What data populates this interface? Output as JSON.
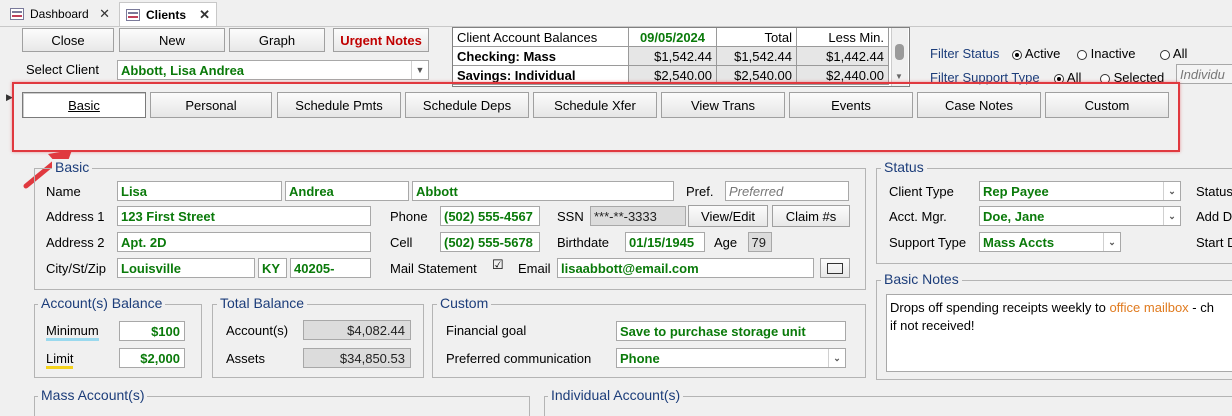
{
  "tabs": {
    "inactive": "Dashboard",
    "active": "Clients"
  },
  "toolbar": {
    "close": "Close",
    "new": "New",
    "graph": "Graph",
    "urgent": "Urgent Notes"
  },
  "select_client": {
    "label": "Select Client",
    "value": "Abbott, Lisa Andrea"
  },
  "balances": {
    "header": [
      "Client Account Balances",
      "09/05/2024",
      "Total",
      "Less Min."
    ],
    "rows": [
      {
        "name": "Checking: Mass",
        "a": "$1,542.44",
        "b": "$1,542.44",
        "c": "$1,442.44"
      },
      {
        "name": "Savings: Individual",
        "a": "$2,540.00",
        "b": "$2,540.00",
        "c": "$2,440.00"
      }
    ]
  },
  "filters": {
    "status_label": "Filter Status",
    "active": "Active",
    "inactive": "Inactive",
    "all": "All",
    "support_label": "Filter Support Type",
    "all2": "All",
    "selected": "Selected",
    "support_value": "Individu"
  },
  "nav": [
    "Basic",
    "Personal",
    "Schedule Pmts",
    "Schedule Deps",
    "Schedule Xfer",
    "View Trans",
    "Events",
    "Case Notes",
    "Custom"
  ],
  "basic": {
    "title": "Basic",
    "name_label": "Name",
    "first": "Lisa",
    "middle": "Andrea",
    "last": "Abbott",
    "pref_label": "Pref.",
    "pref_placeholder": "Preferred",
    "addr1_label": "Address 1",
    "addr1": "123 First Street",
    "addr2_label": "Address 2",
    "addr2": "Apt. 2D",
    "city_label": "City/St/Zip",
    "city": "Louisville",
    "state": "KY",
    "zip": "40205-",
    "phone_label": "Phone",
    "phone": "(502) 555-4567",
    "cell_label": "Cell",
    "cell": "(502) 555-5678",
    "ssn_label": "SSN",
    "ssn": "***-**-3333",
    "view_edit": "View/Edit",
    "claim": "Claim #s",
    "birth_label": "Birthdate",
    "birth": "01/15/1945",
    "age_label": "Age",
    "age": "79",
    "mail_label": "Mail Statement",
    "email_label": "Email",
    "email": "lisaabbott@email.com"
  },
  "status": {
    "title": "Status",
    "type_label": "Client Type",
    "type": "Rep Payee",
    "mgr_label": "Acct. Mgr.",
    "mgr": "Doe, Jane",
    "support_label": "Support Type",
    "support": "Mass Accts",
    "right1": "Status",
    "right2": "Add D",
    "right3": "Start D"
  },
  "notes": {
    "title": "Basic Notes",
    "text1": "Drops off spending receipts weekly to ",
    "link": "office mailbox",
    "text2": " - ch",
    "text3": "if not received!"
  },
  "acct_balance": {
    "title": "Account(s) Balance",
    "min_label": "Minimum",
    "min": "$100",
    "limit_label": "Limit",
    "limit": "$2,000"
  },
  "total": {
    "title": "Total Balance",
    "acct_label": "Account(s)",
    "acct": "$4,082.44",
    "assets_label": "Assets",
    "assets": "$34,850.53"
  },
  "custom": {
    "title": "Custom",
    "goal_label": "Financial goal",
    "goal": "Save to purchase storage unit",
    "comm_label": "Preferred communication",
    "comm": "Phone"
  },
  "mass_title": "Mass Account(s)",
  "indiv_title": "Individual Account(s)",
  "colors": {
    "highlight": "#e0393f",
    "green": "#0a7a0a",
    "blue": "#1c3d7a",
    "orange": "#e07a1e"
  }
}
